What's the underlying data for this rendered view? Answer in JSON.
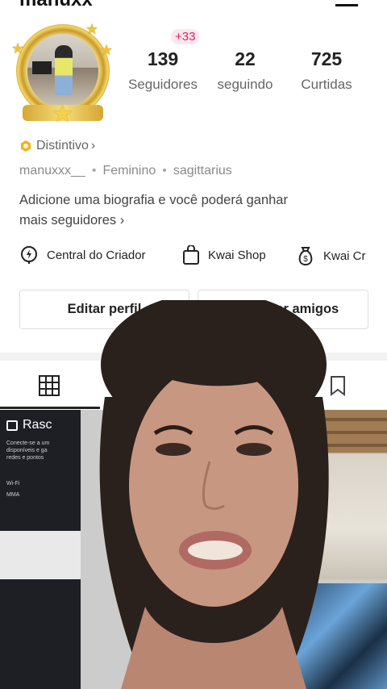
{
  "profile": {
    "followers_badge": "+33",
    "stats": [
      {
        "value": "139",
        "label": "Seguidores"
      },
      {
        "value": "22",
        "label": "seguindo"
      },
      {
        "value": "725",
        "label": "Curtidas"
      }
    ],
    "distintivo_label": "Distintivo",
    "username": "manuxxx__",
    "gender": "Feminino",
    "sign": "sagittarius",
    "bio_line1": "Adicione uma biografia e você poderá ganhar",
    "bio_line2": "mais seguidores"
  },
  "shortcuts": [
    {
      "label": "Central do Criador",
      "icon": "lightning-pin-icon"
    },
    {
      "label": "Kwai Shop",
      "icon": "shopping-bag-icon"
    },
    {
      "label": "Kwai Cr",
      "icon": "money-bag-icon"
    }
  ],
  "actions": {
    "edit_label": "Editar perfil",
    "add_friends_label": "Adicionar amigos"
  },
  "tabs": [
    {
      "icon": "grid-icon",
      "active": true
    },
    {
      "icon": "bookmark-icon",
      "active": false
    }
  ],
  "grid_tile_left": {
    "title": "Rasc",
    "lines": [
      "Conecte-se a um",
      "disponíveis e ga",
      "redes e pontos",
      "Wi-Fi",
      "MMA"
    ]
  },
  "colors": {
    "accent_red": "#e0245e",
    "gold": "#d4a733",
    "text_primary": "#222222",
    "text_secondary": "#666666"
  }
}
